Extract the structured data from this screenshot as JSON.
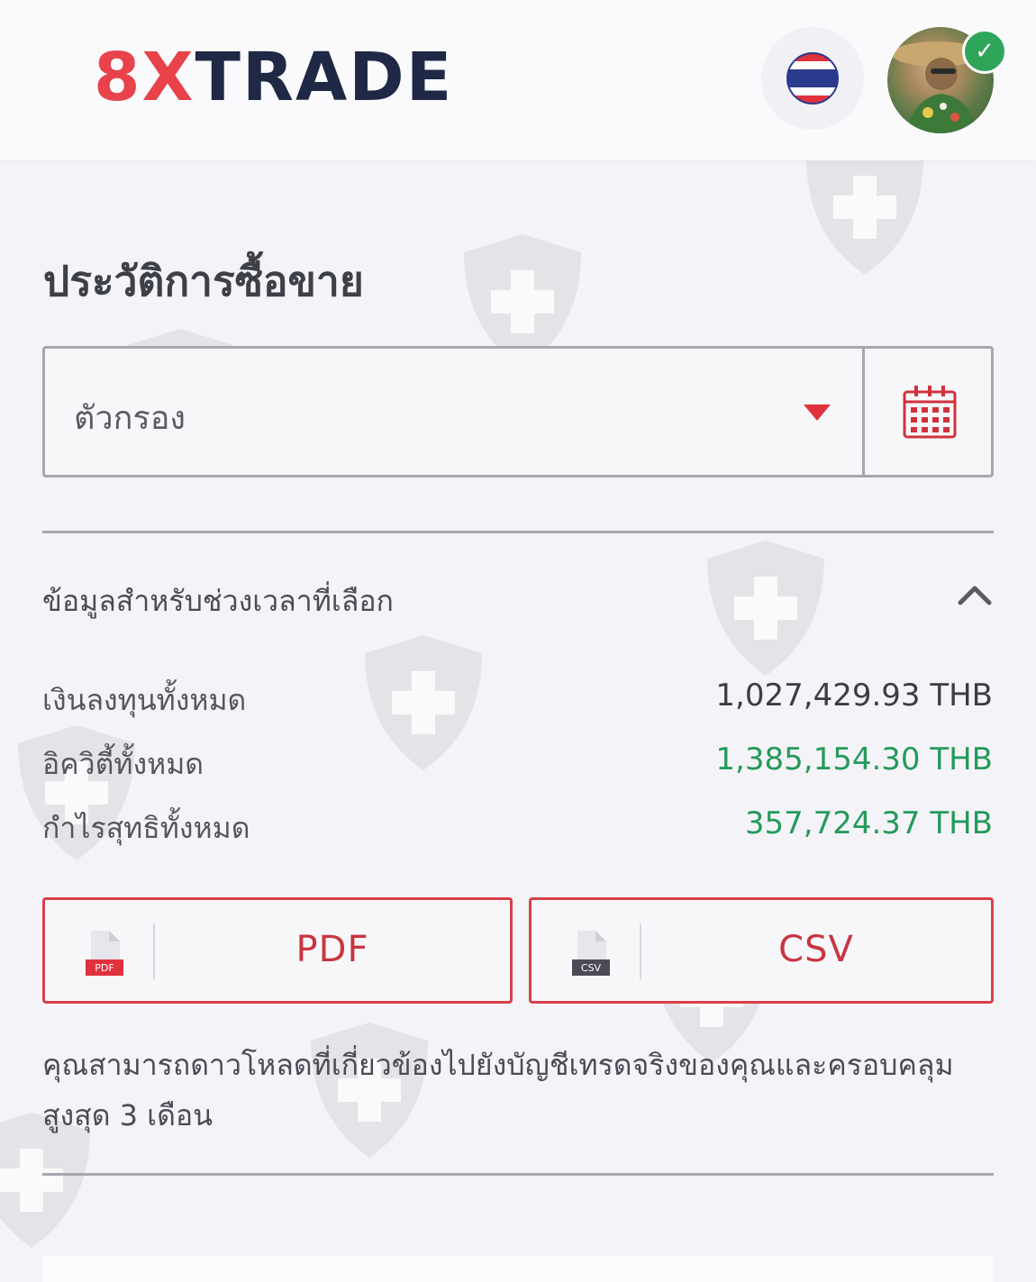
{
  "header": {
    "logo_part1": "8X",
    "logo_part2": "TRADE"
  },
  "page_title": "ประวัติการซื้อขาย",
  "filter": {
    "label": "ตัวกรอง"
  },
  "summary": {
    "title": "ข้อมูลสำหรับช่วงเวลาที่เลือก",
    "rows": [
      {
        "label": "เงินลงทุนทั้งหมด",
        "value": "1,027,429.93 THB"
      },
      {
        "label": "อิควิตี้ทั้งหมด",
        "value": "1,385,154.30 THB"
      },
      {
        "label": "กำไรสุทธิทั้งหมด",
        "value": "357,724.37 THB"
      }
    ]
  },
  "downloads": {
    "pdf_label": "PDF",
    "pdf_tag": "PDF",
    "csv_label": "CSV",
    "csv_tag": "CSV"
  },
  "note": "คุณสามารถดาวโหลดที่เกี่ยวข้องไปยังบัญชีเทรดจริงของคุณและครอบคลุมสูงสุด 3 เดือน",
  "colors": {
    "accent": "#e0323c",
    "green": "#259a5b",
    "navy": "#1f2845"
  }
}
